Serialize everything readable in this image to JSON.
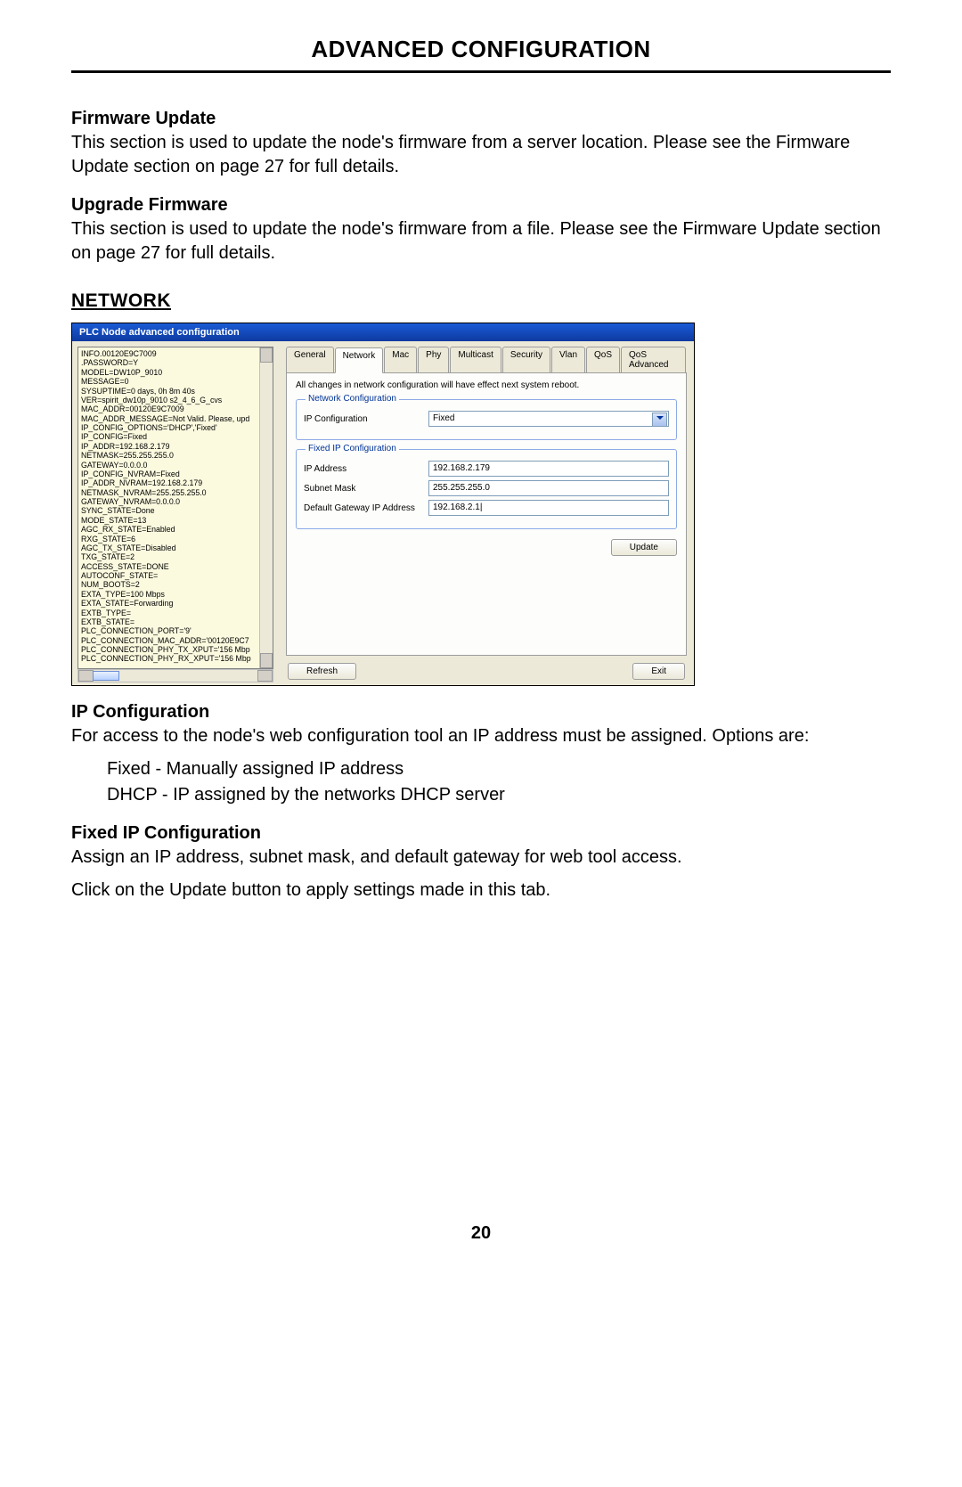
{
  "page": {
    "title": "ADVANCED CONFIGURATION",
    "number": "20"
  },
  "sections": {
    "firmware_update": {
      "heading": "Firmware Update",
      "body": "This section is used to update the node's firmware from a server location. Please see the Firmware Update section on page 27 for full details."
    },
    "upgrade_firmware": {
      "heading": "Upgrade Firmware",
      "body": "This section is used to update the node's firmware from a file. Please see the Firmware Update section on page 27 for full details."
    },
    "network": {
      "heading": "NETWORK"
    },
    "ip_config": {
      "heading": "IP Configuration",
      "body": "For access to the node's web configuration tool an IP address must be assigned. Options are:",
      "opt1": "Fixed - Manually assigned IP address",
      "opt2": "DHCP - IP assigned by the networks DHCP server"
    },
    "fixed_ip": {
      "heading": "Fixed IP Configuration",
      "body": "Assign an IP address, subnet mask, and default gateway for web tool access.",
      "body2": "Click on the Update button to apply settings made in this tab."
    }
  },
  "shot": {
    "titlebar": "PLC Node advanced configuration",
    "info_lines": [
      "INFO.00120E9C7009",
      ".PASSWORD=Y",
      "MODEL=DW10P_9010",
      "MESSAGE=0",
      "SYSUPTIME=0 days, 0h 8m 40s",
      "VER=spirit_dw10p_9010 s2_4_6_G_cvs",
      "MAC_ADDR=00120E9C7009",
      "MAC_ADDR_MESSAGE=Not Valid. Please, upd",
      "IP_CONFIG_OPTIONS='DHCP','Fixed'",
      "IP_CONFIG=Fixed",
      "IP_ADDR=192.168.2.179",
      "NETMASK=255.255.255.0",
      "GATEWAY=0.0.0.0",
      "IP_CONFIG_NVRAM=Fixed",
      "IP_ADDR_NVRAM=192.168.2.179",
      "NETMASK_NVRAM=255.255.255.0",
      "GATEWAY_NVRAM=0.0.0.0",
      "SYNC_STATE=Done",
      "MODE_STATE=13",
      "AGC_RX_STATE=Enabled",
      "RXG_STATE=6",
      "AGC_TX_STATE=Disabled",
      "TXG_STATE=2",
      "ACCESS_STATE=DONE",
      "AUTOCONF_STATE=",
      "NUM_BOOTS=2",
      "EXTA_TYPE=100 Mbps",
      "EXTA_STATE=Forwarding",
      "EXTB_TYPE=",
      "EXTB_STATE=",
      "PLC_CONNECTION_PORT='9'",
      "PLC_CONNECTION_MAC_ADDR='00120E9C7",
      "PLC_CONNECTION_PHY_TX_XPUT='156 Mbp",
      "PLC_CONNECTION_PHY_RX_XPUT='156 Mbp"
    ],
    "tabs": {
      "general": "General",
      "network": "Network",
      "mac": "Mac",
      "phy": "Phy",
      "multicast": "Multicast",
      "security": "Security",
      "vlan": "Vlan",
      "qos": "QoS",
      "qos_adv": "QoS Advanced"
    },
    "note": "All changes in network configuration will have effect next system reboot.",
    "network_config": {
      "legend": "Network Configuration",
      "ipconfig_label": "IP Configuration",
      "ipconfig_value": "Fixed"
    },
    "fixed_ip_config": {
      "legend": "Fixed IP Configuration",
      "ip_label": "IP Address",
      "ip_value": "192.168.2.179",
      "mask_label": "Subnet Mask",
      "mask_value": "255.255.255.0",
      "gw_label": "Default Gateway IP Address",
      "gw_value": "192.168.2.1|"
    },
    "buttons": {
      "update": "Update",
      "refresh": "Refresh",
      "exit": "Exit"
    }
  }
}
